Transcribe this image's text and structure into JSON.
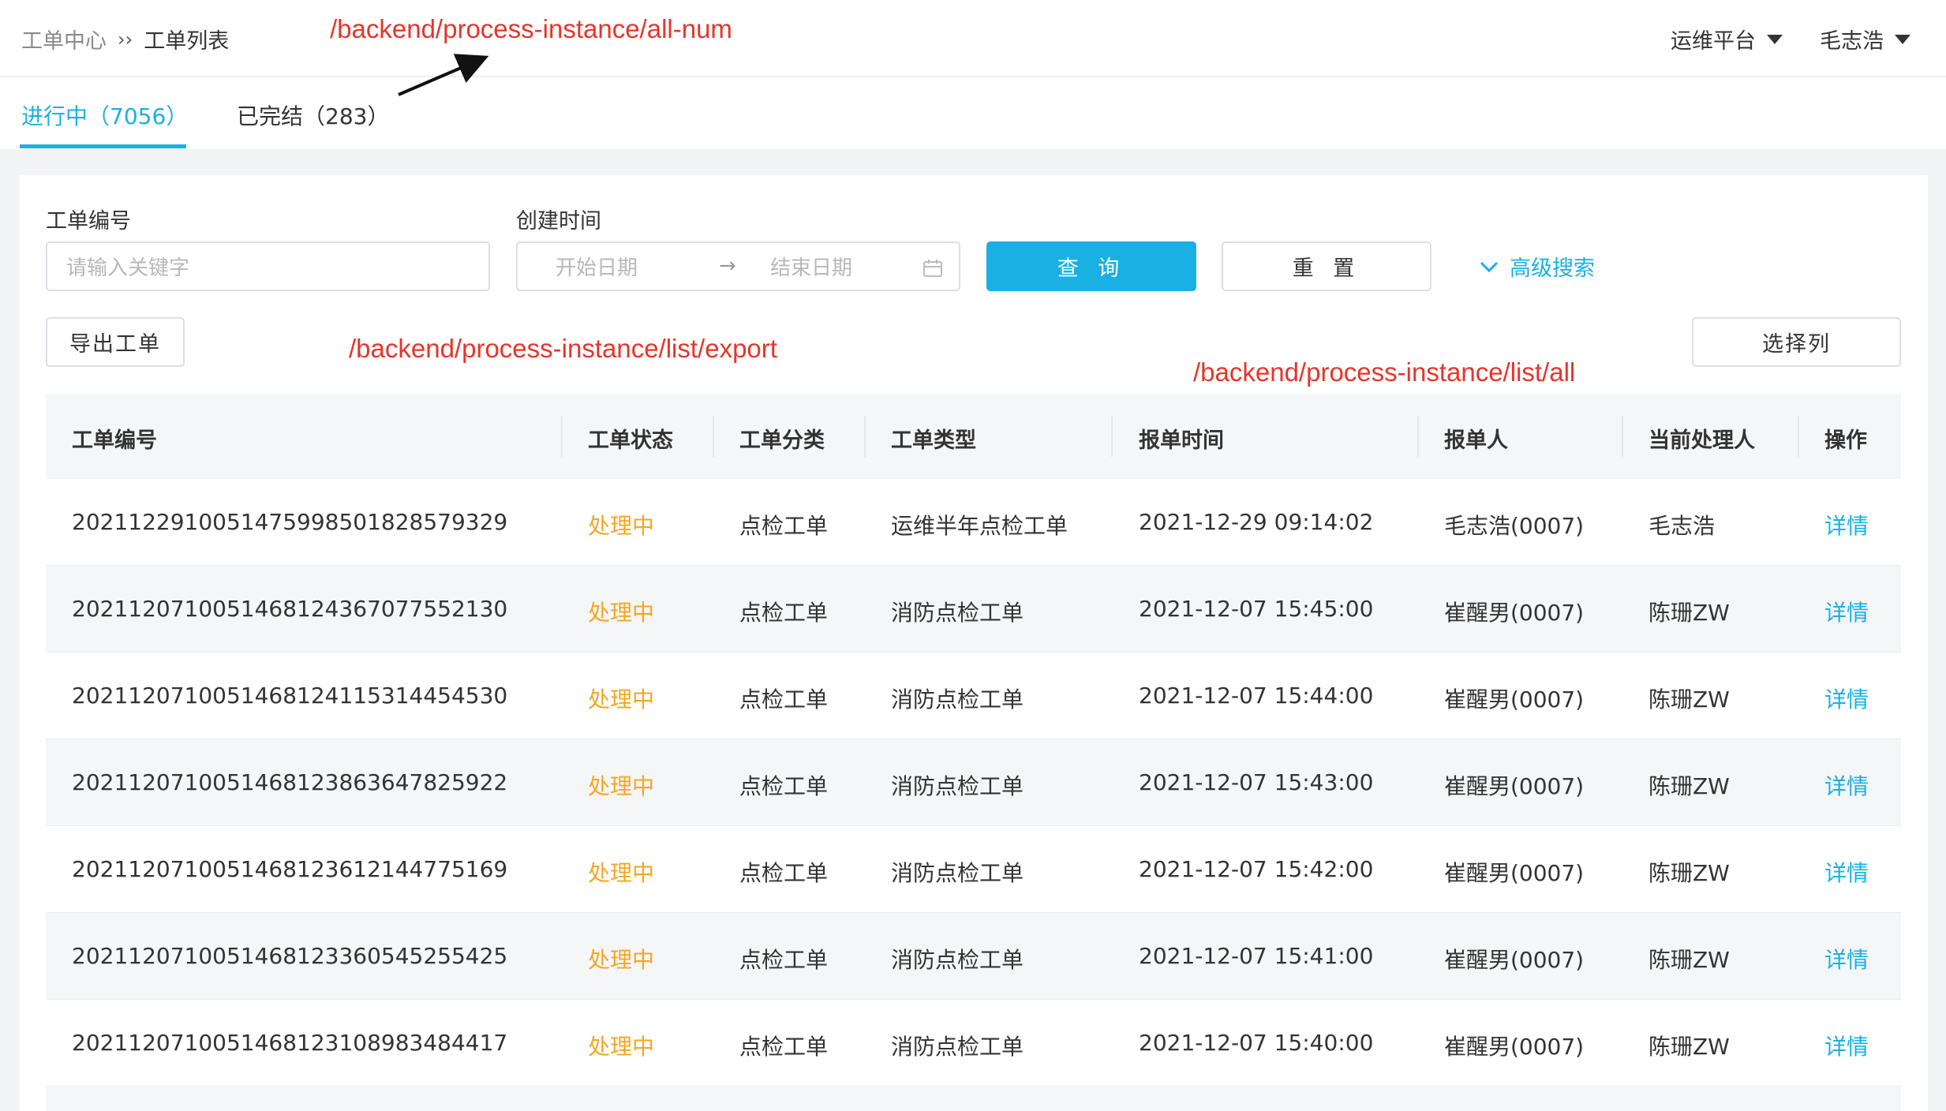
{
  "breadcrumb": {
    "home": "工单中心",
    "separator": "››",
    "current": "工单列表"
  },
  "header": {
    "platform": "运维平台",
    "user": "毛志浩"
  },
  "tabs": [
    {
      "label": "进行中（7056）",
      "active": true
    },
    {
      "label": "已完结（283）",
      "active": false
    }
  ],
  "filters": {
    "order_no_label": "工单编号",
    "order_no_placeholder": "请输入关键字",
    "created_label": "创建时间",
    "start_placeholder": "开始日期",
    "end_placeholder": "结束日期",
    "range_separator": "→",
    "query_label": "查 询",
    "reset_label": "重 置",
    "advanced_label": "高级搜索"
  },
  "actions": {
    "export_label": "导出工单",
    "columns_label": "选择列"
  },
  "annotations": {
    "all_num": "/backend/process-instance/all-num",
    "export": "/backend/process-instance/list/export",
    "list_all": "/backend/process-instance/list/all"
  },
  "table": {
    "columns": [
      "工单编号",
      "工单状态",
      "工单分类",
      "工单类型",
      "报单时间",
      "报单人",
      "当前处理人",
      "操作"
    ],
    "rows": [
      [
        "2021122910051475998501828579329",
        "处理中",
        "点检工单",
        "运维半年点检工单",
        "2021-12-29 09:14:02",
        "毛志浩(0007)",
        "毛志浩",
        "详情"
      ],
      [
        "2021120710051468124367077552130",
        "处理中",
        "点检工单",
        "消防点检工单",
        "2021-12-07 15:45:00",
        "崔醒男(0007)",
        "陈珊ZW",
        "详情"
      ],
      [
        "2021120710051468124115314454530",
        "处理中",
        "点检工单",
        "消防点检工单",
        "2021-12-07 15:44:00",
        "崔醒男(0007)",
        "陈珊ZW",
        "详情"
      ],
      [
        "2021120710051468123863647825922",
        "处理中",
        "点检工单",
        "消防点检工单",
        "2021-12-07 15:43:00",
        "崔醒男(0007)",
        "陈珊ZW",
        "详情"
      ],
      [
        "2021120710051468123612144775169",
        "处理中",
        "点检工单",
        "消防点检工单",
        "2021-12-07 15:42:00",
        "崔醒男(0007)",
        "陈珊ZW",
        "详情"
      ],
      [
        "2021120710051468123360545255425",
        "处理中",
        "点检工单",
        "消防点检工单",
        "2021-12-07 15:41:00",
        "崔醒男(0007)",
        "陈珊ZW",
        "详情"
      ],
      [
        "2021120710051468123108983484417",
        "处理中",
        "点检工单",
        "消防点检工单",
        "2021-12-07 15:40:00",
        "崔醒男(0007)",
        "陈珊ZW",
        "详情"
      ]
    ]
  },
  "colors": {
    "accent": "#1ab0e3",
    "status_processing": "#f5a623",
    "annotation": "#e8342a"
  }
}
